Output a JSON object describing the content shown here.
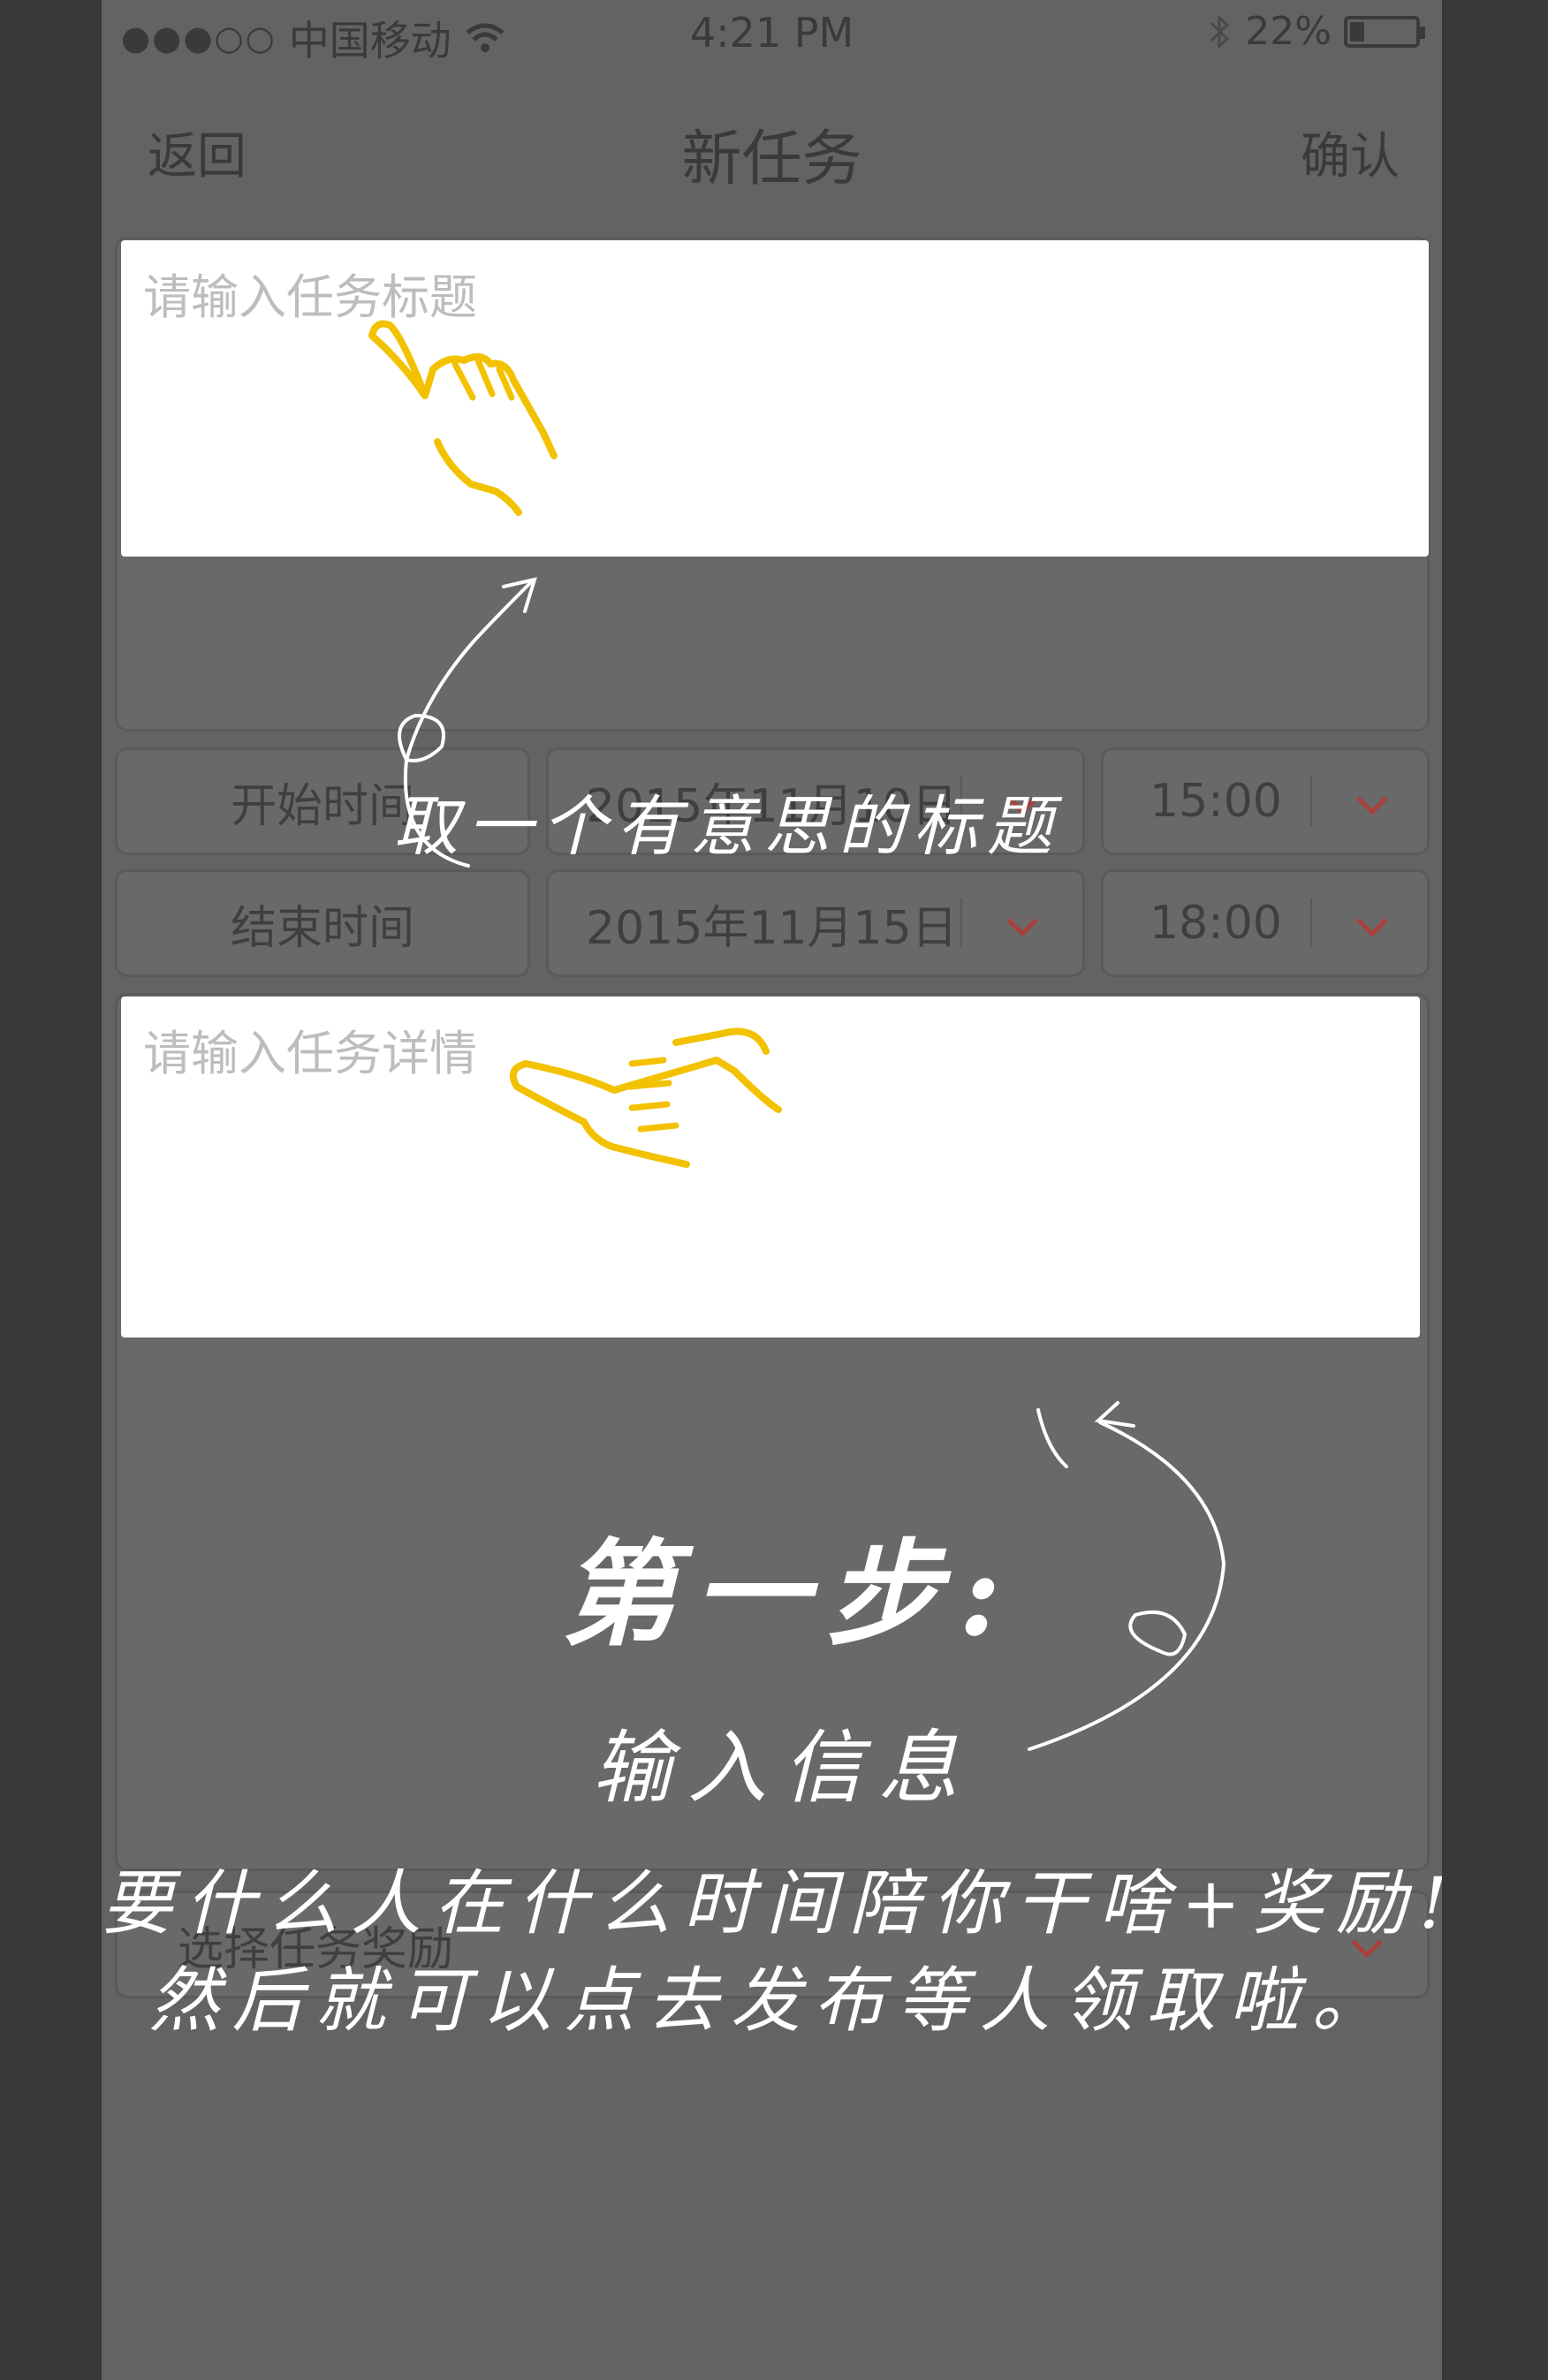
{
  "status_bar": {
    "signal": "●●●○○",
    "carrier": "中国移动",
    "time": "4:21 PM",
    "battery_percent": "22%",
    "battery_level": 0.22,
    "icons": [
      "wifi-icon",
      "bluetooth-icon",
      "battery-icon"
    ]
  },
  "nav": {
    "back_label": "返回",
    "title": "新任务",
    "confirm_label": "确认"
  },
  "form": {
    "title_placeholder": "请输入任务标题",
    "start_label": "开始时间",
    "start_date": "2015年11月10日",
    "start_time": "15:00",
    "end_label": "结束时间",
    "end_date": "2015年11月15日",
    "end_time": "18:00",
    "detail_placeholder": "请输入任务详情",
    "reward_placeholder": "选择任务奖励"
  },
  "annotations": {
    "title_hint": "取一个有意思的标题",
    "step_heading": "第一步:",
    "step_subheading": "输入信息",
    "line1": "要什么人在什么时间陪你干啥+奖励!",
    "line2": "然后就可以点去发布等人领取啦。"
  },
  "colors": {
    "background": "#3a3839",
    "overlay": "#646364",
    "chevron": "#a8403c",
    "hand": "#f2c200",
    "annotation_text": "#ffffff"
  }
}
